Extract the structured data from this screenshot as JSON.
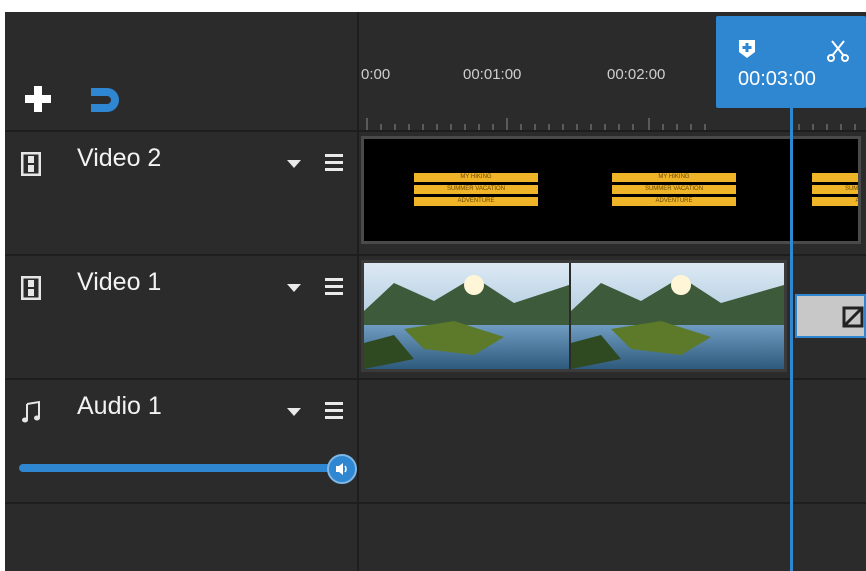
{
  "toolbar": {
    "add_icon": "plus-icon",
    "snap_icon": "magnet-icon"
  },
  "ruler": {
    "labels": [
      "0:00",
      "00:01:00",
      "00:02:00"
    ]
  },
  "playhead": {
    "time": "00:03:00",
    "marker_icon": "add-marker-icon",
    "cut_icon": "scissors-icon"
  },
  "tracks": [
    {
      "name": "Video 2",
      "icon": "film-icon"
    },
    {
      "name": "Video 1",
      "icon": "film-icon"
    },
    {
      "name": "Audio 1",
      "icon": "music-note-icon"
    }
  ],
  "title_clip": {
    "lines": [
      "MY HIKING",
      "SUMMER VACATION",
      "ADVENTURE"
    ]
  },
  "colors": {
    "accent": "#2f86d1",
    "background": "#2b2b2b",
    "title_bar": "#f0b429"
  }
}
